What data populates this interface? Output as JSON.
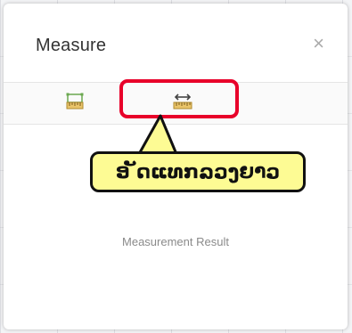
{
  "panel": {
    "title": "Measure",
    "close_glyph": "×"
  },
  "toolbar": {
    "tools": [
      {
        "name": "area",
        "icon": "area-ruler-icon"
      },
      {
        "name": "distance",
        "icon": "distance-ruler-icon"
      }
    ]
  },
  "annotation": {
    "label": "ອ ັດແທກລວງຍາວ",
    "highlight_color": "#e8002a",
    "bubble_color": "#fdfb94"
  },
  "result": {
    "label": "Measurement Result"
  }
}
